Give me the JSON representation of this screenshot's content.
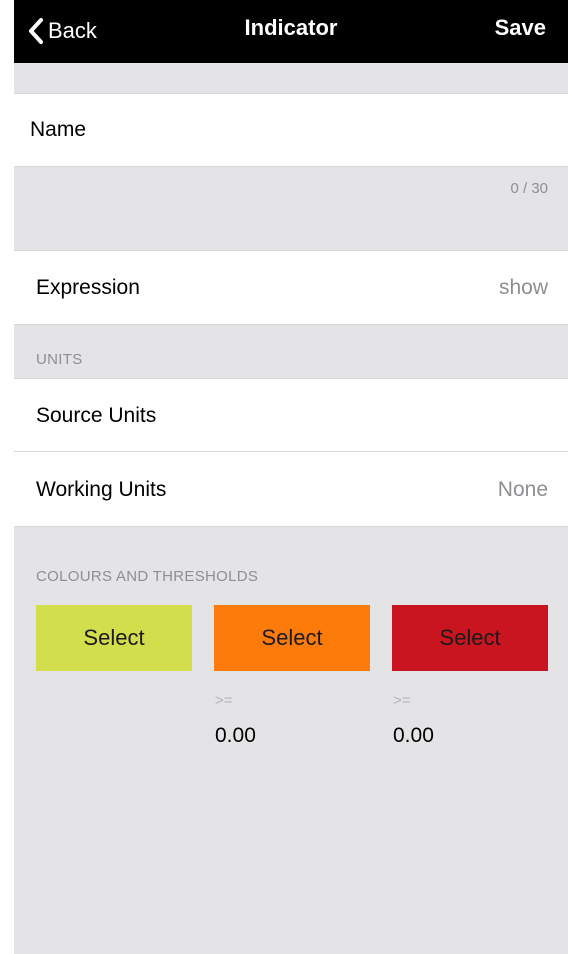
{
  "nav": {
    "back_label": "Back",
    "title": "Indicator",
    "save_label": "Save",
    "back_icon": "chevron-left-icon"
  },
  "name_field": {
    "label": "Name",
    "counter": "0 / 30"
  },
  "expression": {
    "label": "Expression",
    "value": "show"
  },
  "units": {
    "header": "UNITS",
    "source_label": "Source Units",
    "working_label": "Working Units",
    "working_value": "None"
  },
  "colours": {
    "header": "COLOURS AND THRESHOLDS",
    "swatches": [
      {
        "label": "Select",
        "color": "#d2de4b"
      },
      {
        "label": "Select",
        "color": "#fc7b0b"
      },
      {
        "label": "Select",
        "color": "#c8151f"
      }
    ],
    "thresholds": [
      {
        "operator": ">=",
        "value": "0.00"
      },
      {
        "operator": ">=",
        "value": "0.00"
      }
    ]
  }
}
